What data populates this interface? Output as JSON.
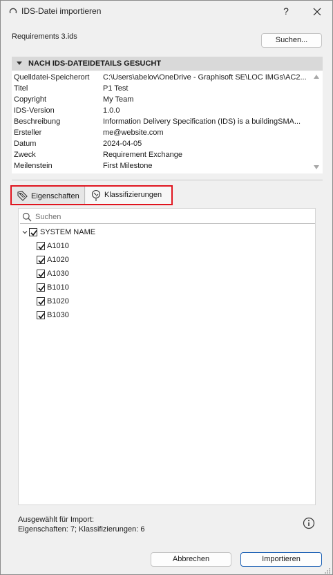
{
  "window": {
    "title": "IDS-Datei importieren",
    "help_label": "?"
  },
  "file": {
    "name": "Requirements 3.ids",
    "search_button": "Suchen..."
  },
  "details": {
    "header": "NACH IDS-DATEIDETAILS GESUCHT",
    "rows": [
      {
        "key": "Quelldatei-Speicherort",
        "value": "C:\\Users\\abelov\\OneDrive - Graphisoft SE\\LOC IMGs\\AC2..."
      },
      {
        "key": "Titel",
        "value": "P1 Test"
      },
      {
        "key": "Copyright",
        "value": "My Team"
      },
      {
        "key": "IDS-Version",
        "value": "1.0.0"
      },
      {
        "key": "Beschreibung",
        "value": "Information Delivery Specification (IDS) is a buildingSMA..."
      },
      {
        "key": "Ersteller",
        "value": "me@website.com"
      },
      {
        "key": "Datum",
        "value": "2024-04-05"
      },
      {
        "key": "Zweck",
        "value": "Requirement Exchange"
      },
      {
        "key": "Meilenstein",
        "value": "First Milestone"
      }
    ]
  },
  "tabs": [
    {
      "label": "Eigenschaften",
      "icon": "tag-icon",
      "active": false
    },
    {
      "label": "Klassifizierungen",
      "icon": "classification-tree-icon",
      "active": true
    }
  ],
  "search": {
    "placeholder": "Suchen",
    "value": ""
  },
  "tree": {
    "root": {
      "label": "SYSTEM NAME",
      "checked": true,
      "expanded": true
    },
    "children": [
      {
        "label": "A1010",
        "checked": true
      },
      {
        "label": "A1020",
        "checked": true
      },
      {
        "label": "A1030",
        "checked": true
      },
      {
        "label": "B1010",
        "checked": true
      },
      {
        "label": "B1020",
        "checked": true
      },
      {
        "label": "B1030",
        "checked": true
      }
    ]
  },
  "summary": {
    "line1": "Ausgewählt für Import:",
    "line2": "Eigenschaften: 7; Klassifizierungen: 6"
  },
  "buttons": {
    "cancel": "Abbrechen",
    "import": "Importieren"
  },
  "colors": {
    "highlight_border": "#e0141e",
    "primary_border": "#1a5fb4"
  }
}
